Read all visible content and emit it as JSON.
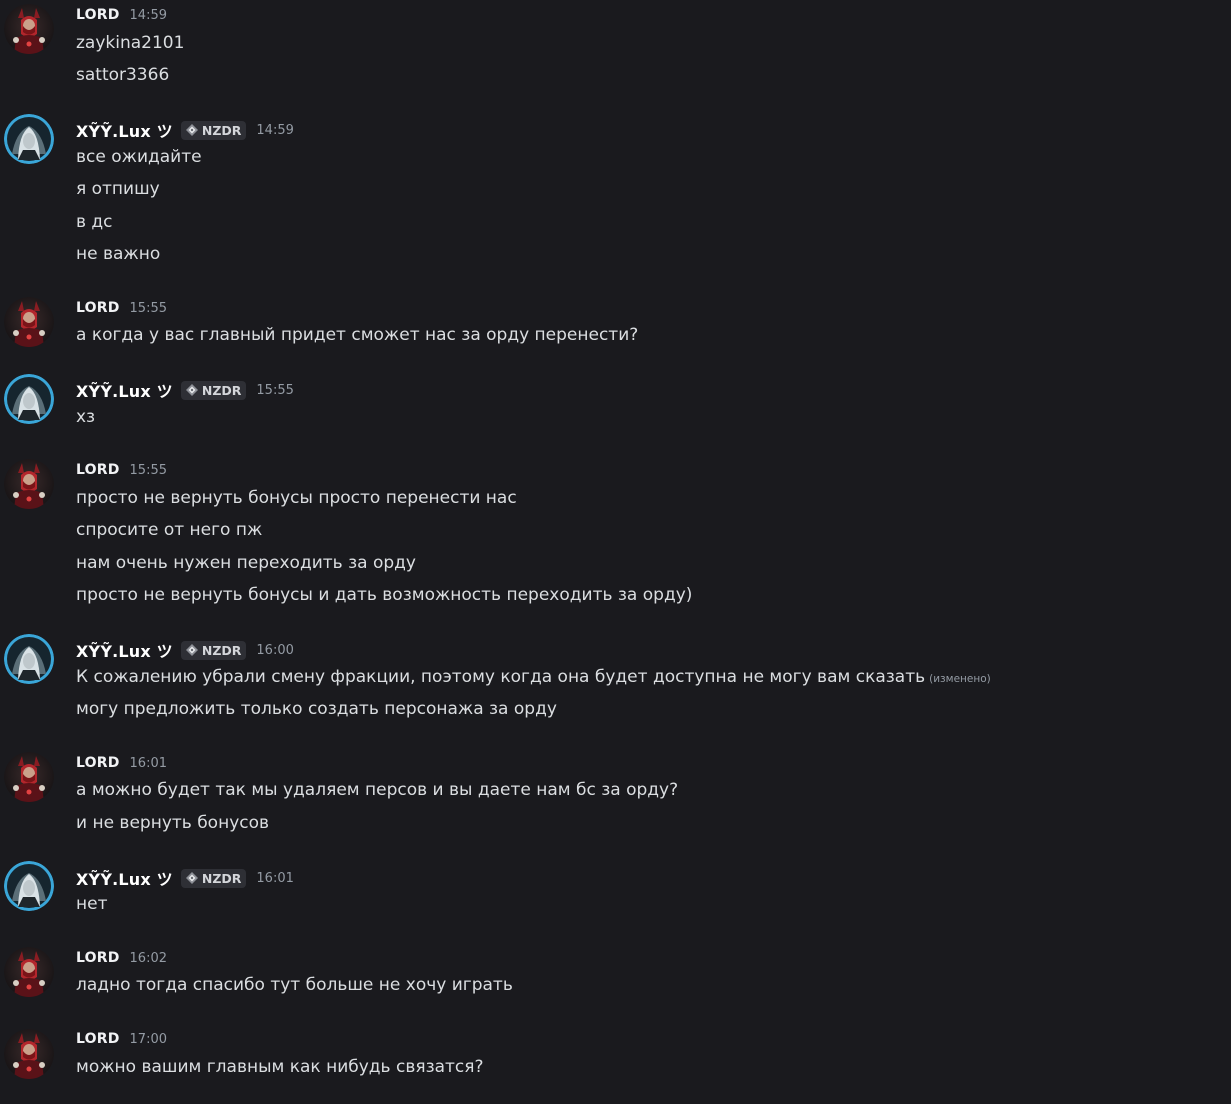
{
  "colors": {
    "background": "#1a1a1e",
    "message_text": "#dbdee1",
    "timestamp": "#949ba4",
    "tag_background": "#2e2f35",
    "avatar_ring_lux": "#3aa6d8",
    "avatar_lord_accent": "#b3262c"
  },
  "users": {
    "lord": {
      "name": "LORD",
      "avatar_icon": "demon-warrior-avatar"
    },
    "lux": {
      "name": "ꓫ𝕐𝕿.ⅈ ux ツ",
      "display": "Ӽ¥ⅲ.ⅈ ux ツ",
      "tag_icon": "clan-diamond-icon",
      "tag": "NZDR",
      "avatar_icon": "white-haired-girl-avatar"
    }
  },
  "messages": [
    {
      "author": "LORD",
      "time": "14:59",
      "lines": [
        "zaykina2101",
        "sattor3366"
      ]
    },
    {
      "author": "XỸỸ.Lux ツ",
      "tag": "NZDR",
      "time": "14:59",
      "lines": [
        "все ожидайте",
        "я отпишу",
        "в дс",
        "не важно"
      ]
    },
    {
      "author": "LORD",
      "time": "15:55",
      "lines": [
        "а когда у вас главный придет сможет нас за орду перенести?"
      ]
    },
    {
      "author": "XỸỸ.Lux ツ",
      "tag": "NZDR",
      "time": "15:55",
      "lines": [
        "хз"
      ]
    },
    {
      "author": "LORD",
      "time": "15:55",
      "lines": [
        "просто не вернуть бонусы просто перенести нас",
        "спросите от него пж",
        "нам очень нужен переходить за орду",
        "просто не вернуть бонусы и дать возможность переходить за орду)"
      ]
    },
    {
      "author": "XỸỸ.Lux ツ",
      "tag": "NZDR",
      "time": "16:00",
      "lines": [
        "К сожалению убрали смену фракции, поэтому когда она будет доступна не могу вам сказать",
        "могу предложить только создать персонажа за орду"
      ],
      "edited": "(изменено)"
    },
    {
      "author": "LORD",
      "time": "16:01",
      "lines": [
        "а можно будет так мы удаляем персов и вы даете нам бс за орду?",
        "и не вернуть бонусов"
      ]
    },
    {
      "author": "XỸỸ.Lux ツ",
      "tag": "NZDR",
      "time": "16:01",
      "lines": [
        "нет"
      ]
    },
    {
      "author": "LORD",
      "time": "16:02",
      "lines": [
        "ладно тогда спасибо тут больше не хочу играть"
      ]
    },
    {
      "author": "LORD",
      "time": "17:00",
      "lines": [
        "можно вашим главным как нибудь связатся?"
      ]
    }
  ]
}
